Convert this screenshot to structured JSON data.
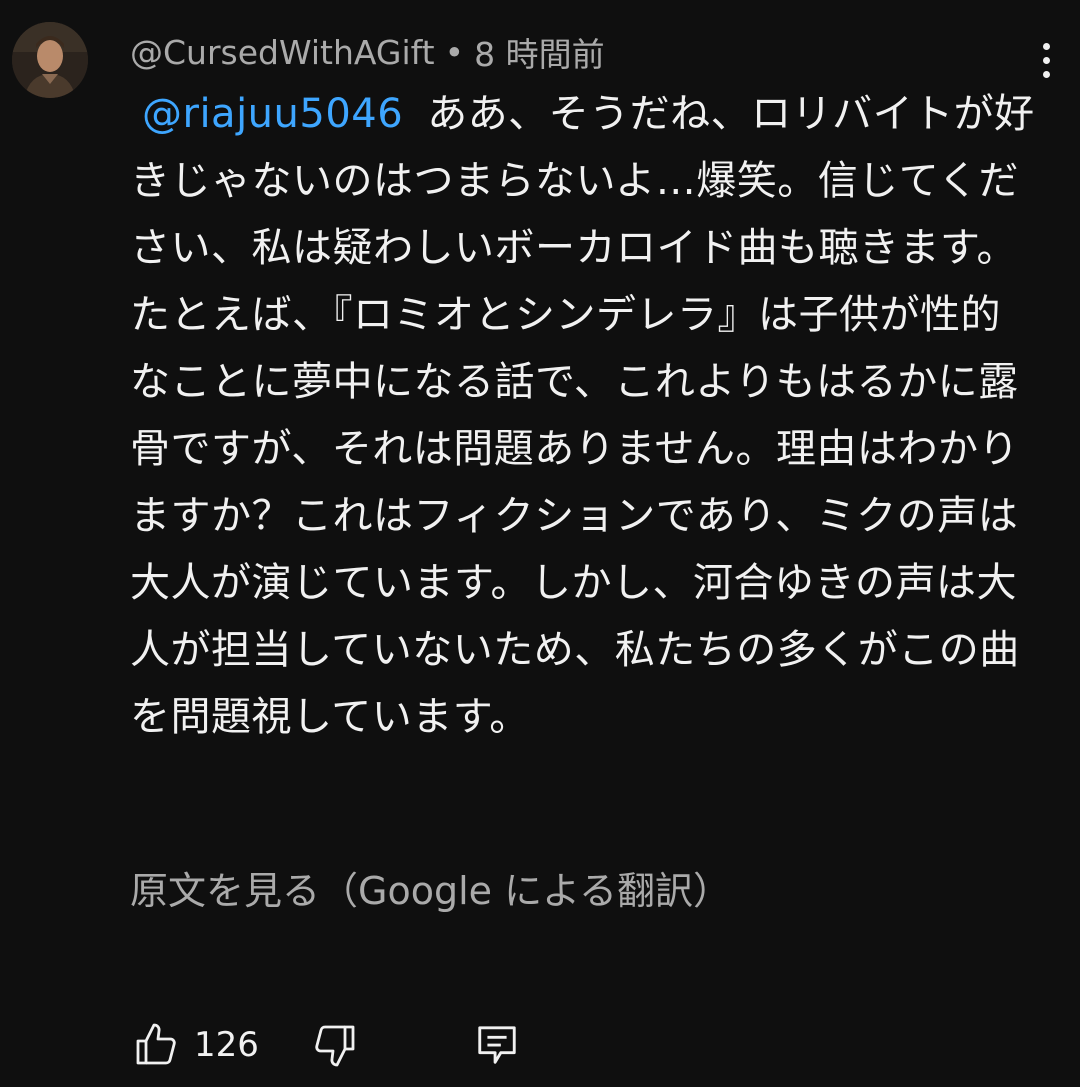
{
  "comment": {
    "author_handle": "@CursedWithAGift",
    "separator": "•",
    "time_ago": "8 時間前",
    "mention": "@riajuu5046",
    "text": "ああ、そうだね、ロリバイトが好きじゃないのはつまらないよ…爆笑。信じてください、私は疑わしいボーカロイド曲も聴きます。たとえば、『ロミオとシンデレラ』は子供が性的なことに夢中になる話で、これよりもはるかに露骨ですが、それは問題ありません。理由はわかりますか？これはフィクションであり、ミクの声は大人が演じています。しかし、河合ゆきの声は大人が担当していないため、私たちの多くがこの曲を問題視しています。",
    "translate_link": "原文を見る（Google による翻訳）",
    "like_count": "126"
  },
  "icons": {
    "avatar": "avatar",
    "menu": "more-vert-icon",
    "like": "thumbs-up-icon",
    "dislike": "thumbs-down-icon",
    "reply": "reply-comment-icon"
  },
  "colors": {
    "background": "#0f0f0f",
    "text": "#f1f1f1",
    "secondary_text": "#aaaaaa",
    "mention": "#3ea6ff"
  }
}
